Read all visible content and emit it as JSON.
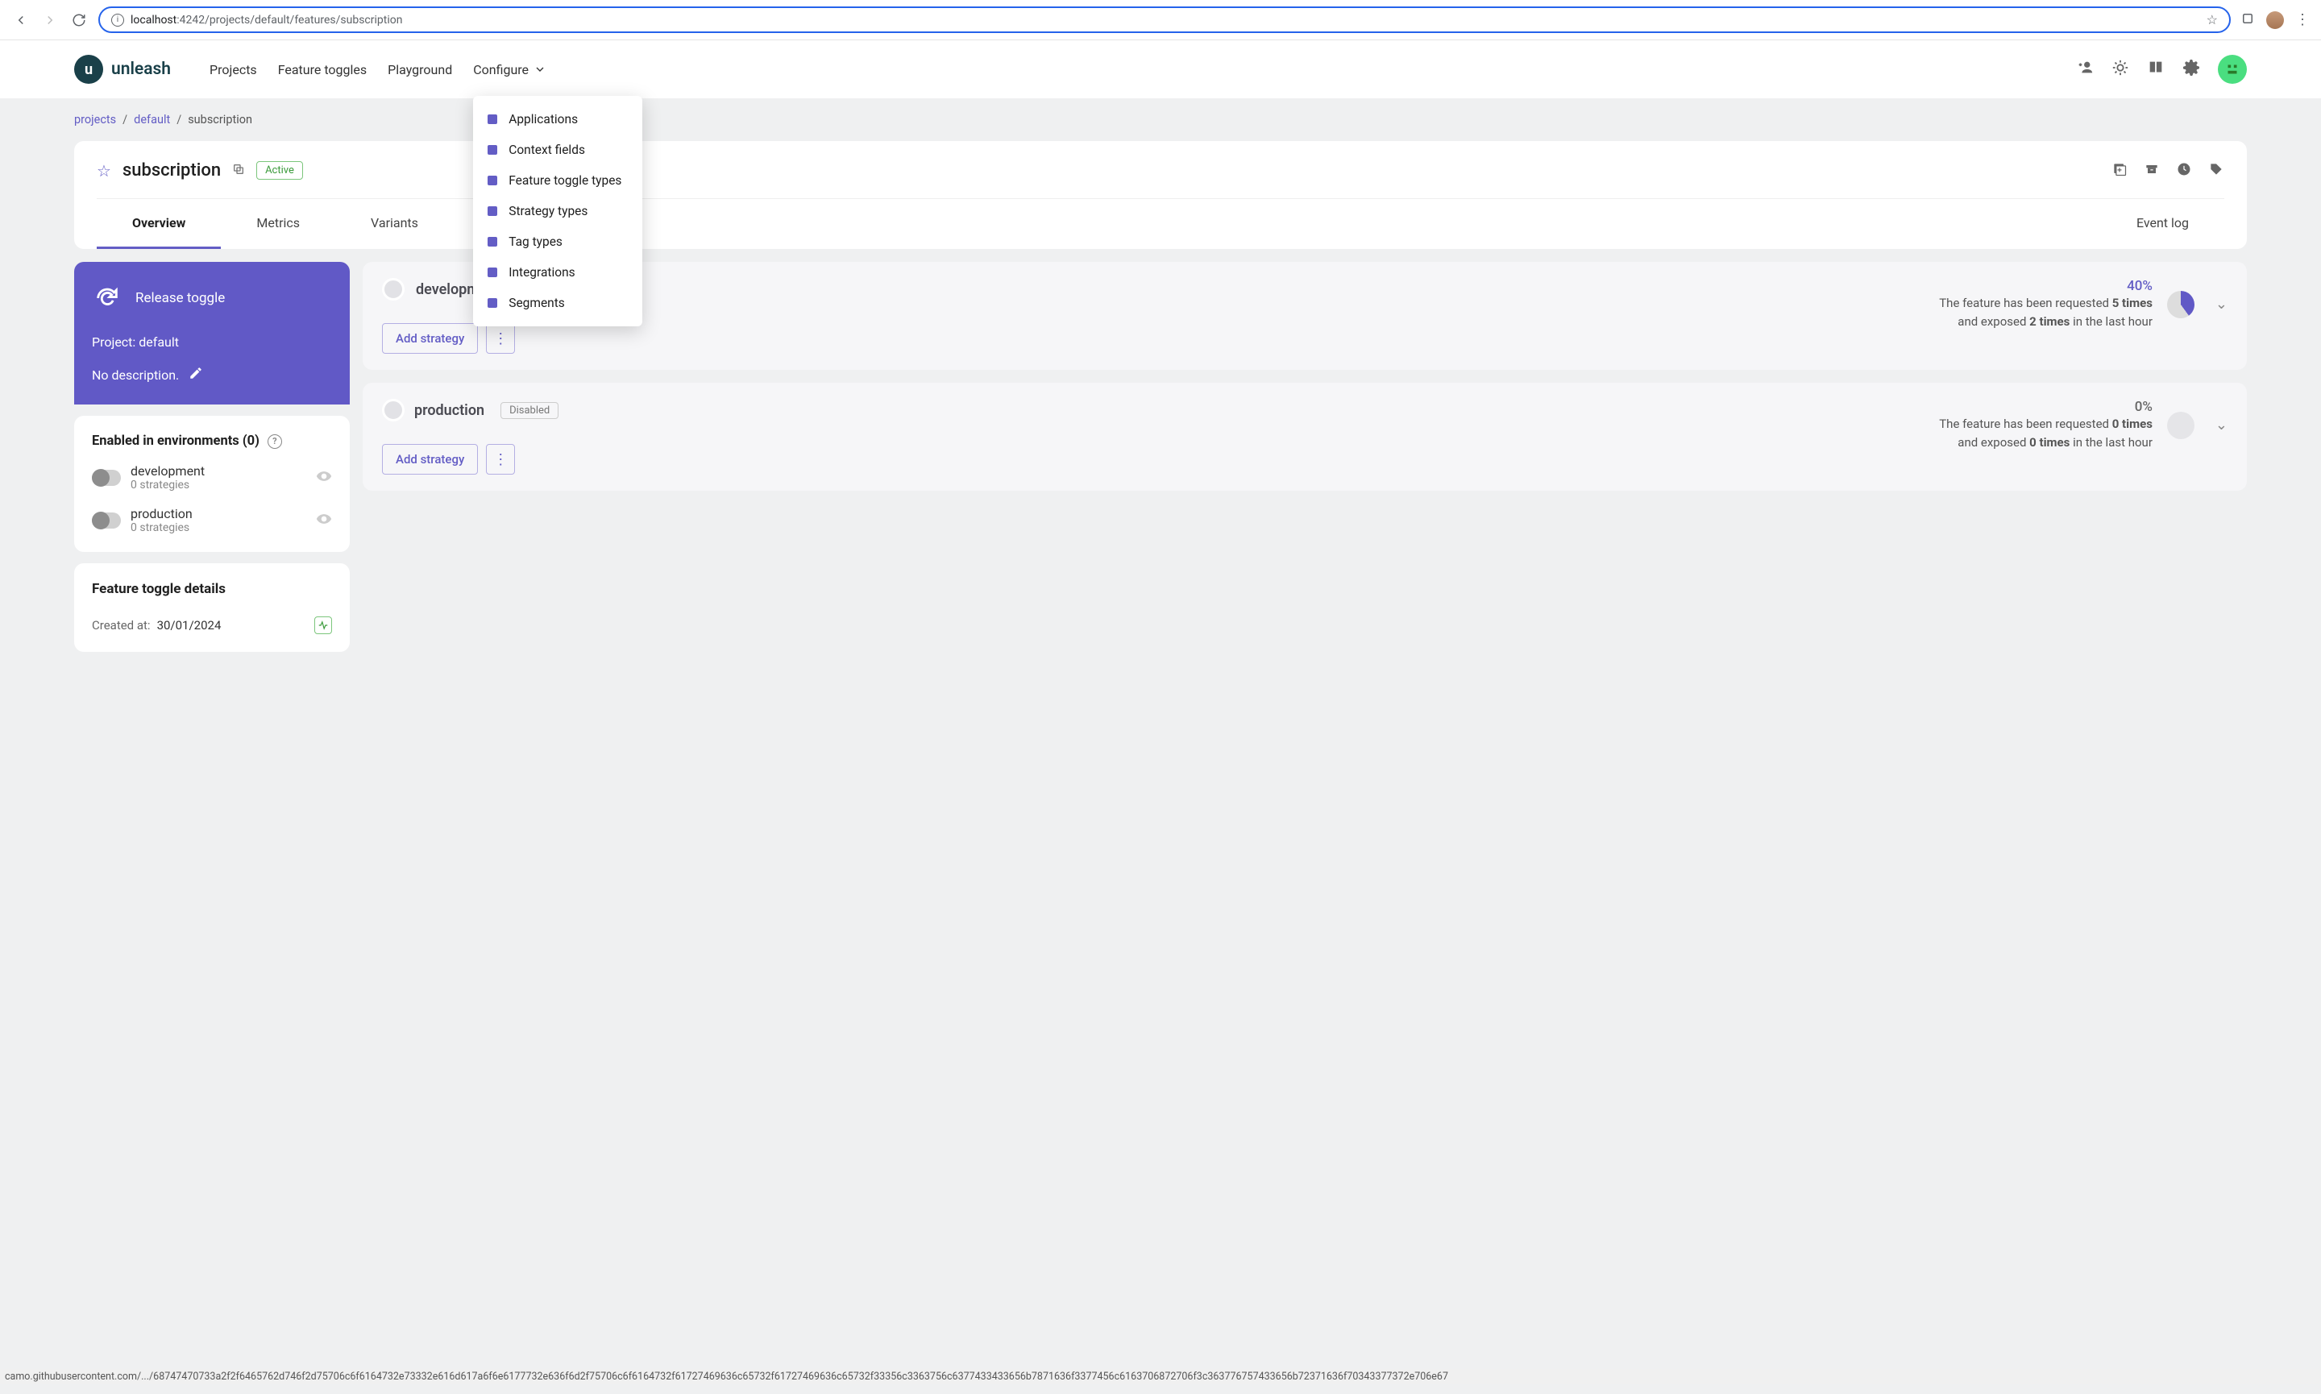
{
  "browser": {
    "url_host": "localhost",
    "url_port": ":4242",
    "url_path": "/projects/default/features/subscription",
    "status_bar": "camo.githubusercontent.com/.../68747470733a2f2f6465762d746f2d75706c6f6164732e73332e616d617a6f6e6177732e636f6d2f75706c6f6164732f61727469636c65732f61727469636c65732f33356c3363756c6377433433656b7871636f3377456c6163706872706f3c363776757433656b72371636f70343377372e706e67"
  },
  "nav": {
    "logo": "unleash",
    "projects": "Projects",
    "feature_toggles": "Feature toggles",
    "playground": "Playground",
    "configure": "Configure"
  },
  "configure_menu": [
    "Applications",
    "Context fields",
    "Feature toggle types",
    "Strategy types",
    "Tag types",
    "Integrations",
    "Segments"
  ],
  "breadcrumb": {
    "projects": "projects",
    "project": "default",
    "current": "subscription"
  },
  "feature": {
    "name": "subscription",
    "status": "Active"
  },
  "tabs": [
    "Overview",
    "Metrics",
    "Variants",
    "Event log"
  ],
  "release_panel": {
    "title": "Release toggle",
    "project_label": "Project: default",
    "description": "No description."
  },
  "env_panel": {
    "title": "Enabled in environments (0)",
    "items": [
      {
        "name": "development",
        "sub": "0 strategies"
      },
      {
        "name": "production",
        "sub": "0 strategies"
      }
    ]
  },
  "details_panel": {
    "title": "Feature toggle details",
    "created_label": "Created at:",
    "created_value": "30/01/2024"
  },
  "env_cards": {
    "development": {
      "name": "development",
      "pct": "40%",
      "line1_pre": "The feature has been requested ",
      "line1_b": "5 times",
      "line2_pre": "and exposed ",
      "line2_b": "2 times",
      "line2_post": " in the last hour",
      "add_strategy": "Add strategy"
    },
    "production": {
      "name": "production",
      "disabled": "Disabled",
      "pct": "0%",
      "line1_pre": "The feature has been requested ",
      "line1_b": "0 times",
      "line2_pre": "and exposed ",
      "line2_b": "0 times",
      "line2_post": " in the last hour",
      "add_strategy": "Add strategy"
    }
  }
}
